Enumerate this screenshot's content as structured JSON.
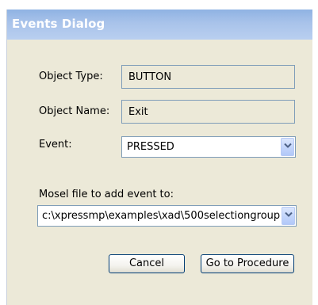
{
  "dialog": {
    "title": "Events Dialog"
  },
  "form": {
    "object_type": {
      "label": "Object Type:",
      "value": "BUTTON"
    },
    "object_name": {
      "label": "Object Name:",
      "value": "Exit"
    },
    "event": {
      "label": "Event:",
      "selected": "PRESSED"
    },
    "mosel_file": {
      "label": "Mosel file to add event to:",
      "selected": "c:\\xpressmp\\examples\\xad\\500selectiongroup"
    }
  },
  "buttons": {
    "cancel": "Cancel",
    "go_to_procedure": "Go to Procedure"
  },
  "colors": {
    "titlebar": "#a9c3ea",
    "dialog_bg": "#ece9d8",
    "field_border": "#7f9db9",
    "button_border": "#003c74"
  },
  "icons": {
    "dropdown": "chevron-down-icon"
  }
}
